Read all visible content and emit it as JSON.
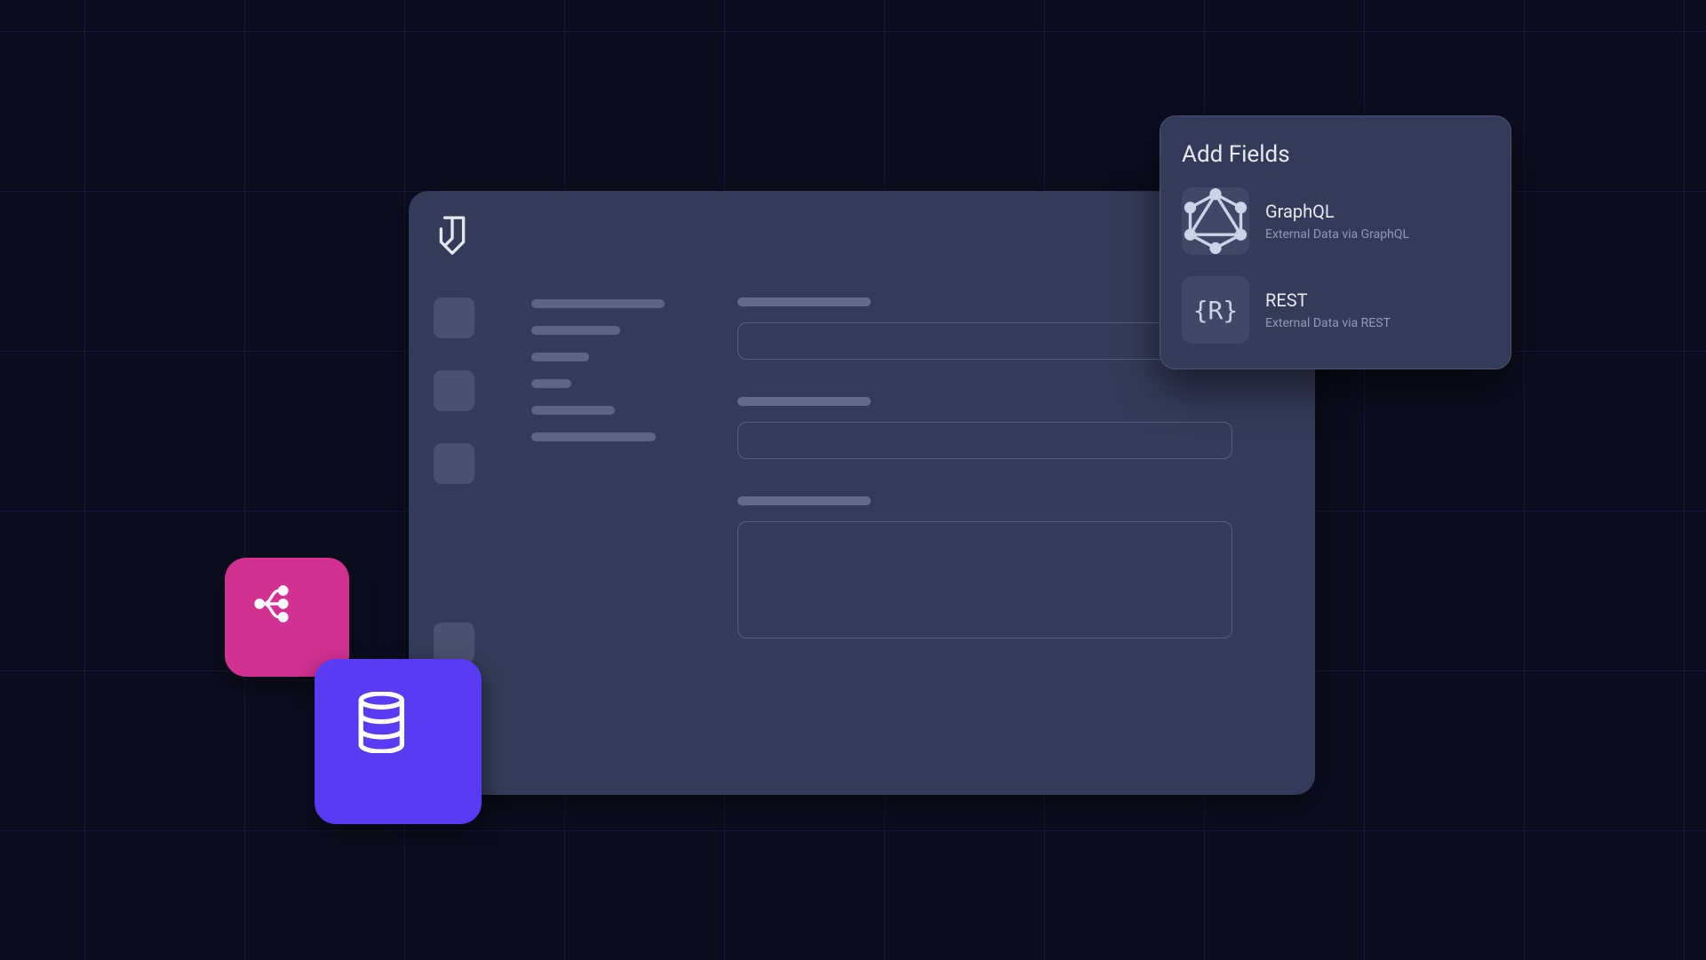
{
  "popover": {
    "title": "Add Fields",
    "options": [
      {
        "icon": "graphql",
        "title": "GraphQL",
        "subtitle": "External Data via GraphQL"
      },
      {
        "icon": "rest",
        "title": "REST",
        "subtitle": "External Data via REST"
      }
    ]
  },
  "icons": {
    "rest_glyph": "{R}"
  },
  "colors": {
    "background": "#0b0e1f",
    "panel": "#333b58",
    "accent_pink": "#d33192",
    "accent_purple": "#5a3bf5"
  }
}
